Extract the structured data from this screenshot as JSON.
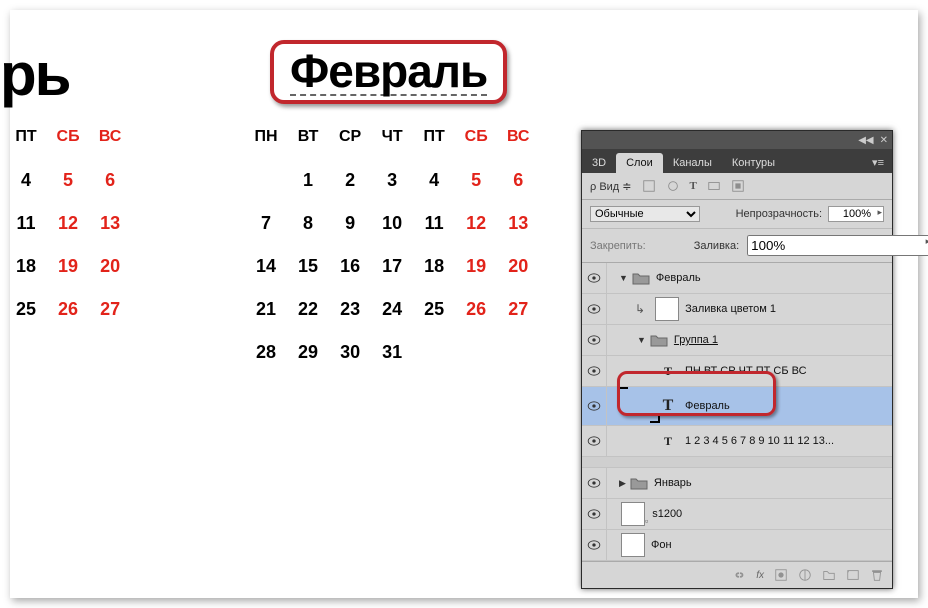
{
  "jan_cut": "рь",
  "month_title": "Февраль",
  "days": {
    "mon": "ПН",
    "tue": "ВТ",
    "wed": "СР",
    "thu": "ЧТ",
    "fri": "ПТ",
    "sat": "СБ",
    "sun": "ВС"
  },
  "jan_rows": [
    [
      "4",
      "5",
      "6"
    ],
    [
      "11",
      "12",
      "13"
    ],
    [
      "18",
      "19",
      "20"
    ],
    [
      "25",
      "26",
      "27"
    ]
  ],
  "feb_rows": [
    [
      "",
      "1",
      "2",
      "3",
      "4",
      "5",
      "6"
    ],
    [
      "7",
      "8",
      "9",
      "10",
      "11",
      "12",
      "13"
    ],
    [
      "14",
      "15",
      "16",
      "17",
      "18",
      "19",
      "20"
    ],
    [
      "21",
      "22",
      "23",
      "24",
      "25",
      "26",
      "27"
    ],
    [
      "28",
      "29",
      "30",
      "31",
      "",
      "",
      ""
    ]
  ],
  "panel": {
    "tabs": {
      "t3d": "3D",
      "layers": "Слои",
      "channels": "Каналы",
      "paths": "Контуры"
    },
    "kind": "Вид",
    "blend": "Обычные",
    "opacity_label": "Непрозрачность:",
    "opacity_value": "100%",
    "lock_label": "Закрепить:",
    "fill_label": "Заливка:",
    "fill_value": "100%",
    "layers_list": {
      "feb_group": "Февраль",
      "fill_color": "Заливка цветом 1",
      "group1": "Группа 1",
      "weekdays": "ПН ВТ СР ЧТ ПТ СБ ВС",
      "feb_text": "Февраль",
      "numbers": "1  2  3  4  5  6  7  8  9 10 11 12 13...",
      "jan_group": "Январь",
      "s1200": "s1200",
      "background": "Фон"
    },
    "fx": "fx"
  }
}
